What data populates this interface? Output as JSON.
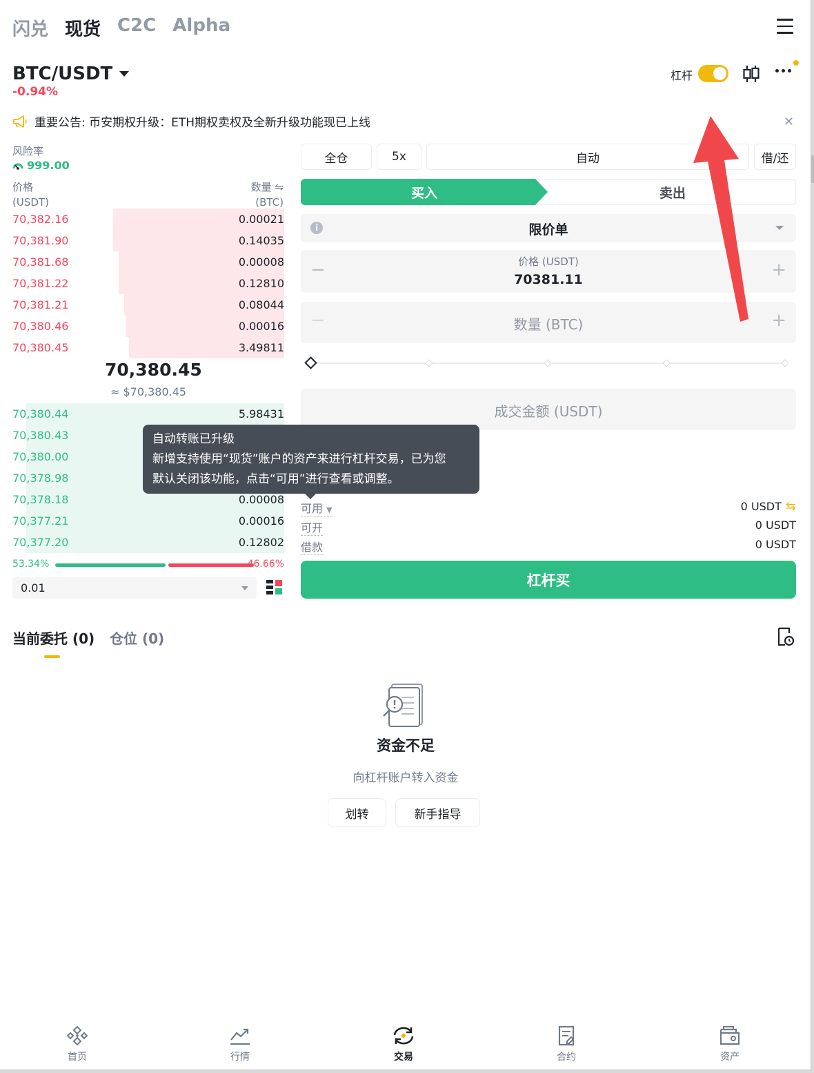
{
  "top_nav": {
    "items": [
      "闪兑",
      "现货",
      "C2C",
      "Alpha"
    ],
    "active_index": 1
  },
  "pair": {
    "symbol": "BTC/USDT",
    "change": "-0.94%"
  },
  "header": {
    "leverage_label": "杠杆",
    "leverage_enabled": true
  },
  "announcement": {
    "text": "重要公告: 币安期权升级：ETH期权卖权及全新升级功能现已上线"
  },
  "risk": {
    "label": "风险率",
    "value": "999.00"
  },
  "order_book": {
    "price_header": "价格",
    "price_unit": "(USDT)",
    "qty_header": "数量 ⇋",
    "qty_unit": "(BTC)",
    "asks": [
      {
        "price": "70,382.16",
        "qty": "0.00021",
        "depth": 0.63
      },
      {
        "price": "70,381.90",
        "qty": "0.14035",
        "depth": 0.63
      },
      {
        "price": "70,381.68",
        "qty": "0.00008",
        "depth": 0.61
      },
      {
        "price": "70,381.22",
        "qty": "0.12810",
        "depth": 0.61
      },
      {
        "price": "70,381.21",
        "qty": "0.08044",
        "depth": 0.59
      },
      {
        "price": "70,380.46",
        "qty": "0.00016",
        "depth": 0.58
      },
      {
        "price": "70,380.45",
        "qty": "3.49811",
        "depth": 0.57
      }
    ],
    "mid_price": "70,380.45",
    "mid_price_usd": "≈ $70,380.45",
    "bids": [
      {
        "price": "70,380.44",
        "qty": "5.98431",
        "depth": 0.95
      },
      {
        "price": "70,380.43",
        "qty": "",
        "depth": 0.95
      },
      {
        "price": "70,380.00",
        "qty": "",
        "depth": 0.95
      },
      {
        "price": "70,378.98",
        "qty": "",
        "depth": 0.95
      },
      {
        "price": "70,378.18",
        "qty": "0.00008",
        "depth": 0.95
      },
      {
        "price": "70,377.21",
        "qty": "0.00016",
        "depth": 0.95
      },
      {
        "price": "70,377.20",
        "qty": "0.12802",
        "depth": 0.95
      }
    ],
    "buy_ratio": "53.34%",
    "sell_ratio": "46.66%",
    "tick_size": "0.01"
  },
  "trade_panel": {
    "margin_mode": "全仓",
    "leverage": "5x",
    "borrow_mode": "自动",
    "borrow_repay": "借/还",
    "buy_tab": "买入",
    "sell_tab": "卖出",
    "order_type": "限价单",
    "price_label": "价格 (USDT)",
    "price_value": "70381.11",
    "qty_placeholder": "数量 (BTC)",
    "total_placeholder": "成交金额 (USDT)",
    "slider_percent": 0,
    "available_label": "可用",
    "available_value": "0 USDT",
    "max_open_label": "可开",
    "max_open_value": "0 USDT",
    "borrowed_label": "借款",
    "borrowed_value": "0 USDT",
    "submit_label": "杠杆买"
  },
  "tooltip": {
    "title": "自动转账已升级",
    "line1": "新增支持使用“现货”账户的资产来进行杠杆交易，已为您",
    "line2": "默认关闭该功能，点击“可用”进行查看或调整。"
  },
  "orders": {
    "tab_open": "当前委托 (0)",
    "tab_positions": "仓位 (0)",
    "empty_title": "资金不足",
    "empty_subtitle": "向杠杆账户转入资金",
    "transfer_button": "划转",
    "guide_button": "新手指导"
  },
  "bottom_nav": [
    {
      "label": "首页",
      "icon": "home-icon"
    },
    {
      "label": "行情",
      "icon": "markets-icon"
    },
    {
      "label": "交易",
      "icon": "trade-icon",
      "active": true
    },
    {
      "label": "合约",
      "icon": "futures-icon"
    },
    {
      "label": "资产",
      "icon": "wallet-icon"
    }
  ],
  "colors": {
    "accent": "#f0b90b",
    "buy": "#2ebd85",
    "sell": "#f6465d",
    "annotation_arrow": "#f0484a"
  }
}
